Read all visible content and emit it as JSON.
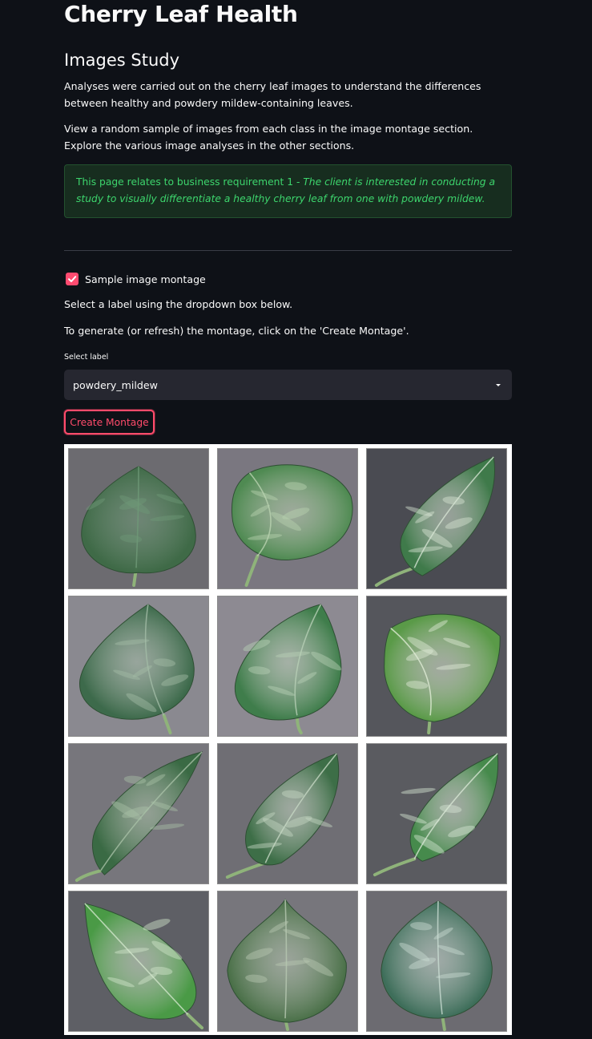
{
  "app_title": "Cherry Leaf Health",
  "page_title": "Images Study",
  "intro": {
    "paragraph_1": "Analyses were carried out on the cherry leaf images to understand the differences between healthy and powdery mildew-containing leaves.",
    "paragraph_2": "View a random sample of images from each class in the image montage section. Explore the various image analyses in the other sections."
  },
  "info_box": {
    "prefix": "This page relates to business requirement 1 - ",
    "emphasis": "The client is interested in conducting a study to visually differentiate a healthy cherry leaf from one with powdery mildew."
  },
  "montage_section": {
    "checkbox_label": "Sample image montage",
    "checkbox_checked": true,
    "instruction_1": "Select a label using the dropdown box below.",
    "instruction_2": "To generate (or refresh) the montage, click on the 'Create Montage'.",
    "select_label": "Select label",
    "select_value": "powdery_mildew",
    "button_label": "Create Montage"
  },
  "montage_images": [
    {
      "name": "leaf-image-1",
      "leaf": "#3f6a47",
      "mildew": "#6f9a78",
      "bg": "#6c6b70"
    },
    {
      "name": "leaf-image-2",
      "leaf": "#4f8a52",
      "mildew": "#b9d2b0",
      "bg": "#7a7780"
    },
    {
      "name": "leaf-image-3",
      "leaf": "#3f7a4a",
      "mildew": "#d6e4d3",
      "bg": "#4a4b52"
    },
    {
      "name": "leaf-image-4",
      "leaf": "#3d6a4b",
      "mildew": "#a3bca6",
      "bg": "#8a8990"
    },
    {
      "name": "leaf-image-5",
      "leaf": "#3f7d4b",
      "mildew": "#b8d0b6",
      "bg": "#8d8a92"
    },
    {
      "name": "leaf-image-6",
      "leaf": "#5a9a48",
      "mildew": "#e0ecd6",
      "bg": "#55565c"
    },
    {
      "name": "leaf-image-7",
      "leaf": "#3a6a44",
      "mildew": "#a8c0a6",
      "bg": "#77767c"
    },
    {
      "name": "leaf-image-8",
      "leaf": "#3d6e47",
      "mildew": "#c5d7c3",
      "bg": "#6f6e74"
    },
    {
      "name": "leaf-image-9",
      "leaf": "#468a4c",
      "mildew": "#d8e6d4",
      "bg": "#5a5b60"
    },
    {
      "name": "leaf-image-10",
      "leaf": "#4a9a46",
      "mildew": "#d2e6cc",
      "bg": "#5e5f65"
    },
    {
      "name": "leaf-image-11",
      "leaf": "#4a7048",
      "mildew": "#b7c8b2",
      "bg": "#77767c"
    },
    {
      "name": "leaf-image-12",
      "leaf": "#3e6e5a",
      "mildew": "#c9dcd2",
      "bg": "#6c6b71"
    }
  ]
}
